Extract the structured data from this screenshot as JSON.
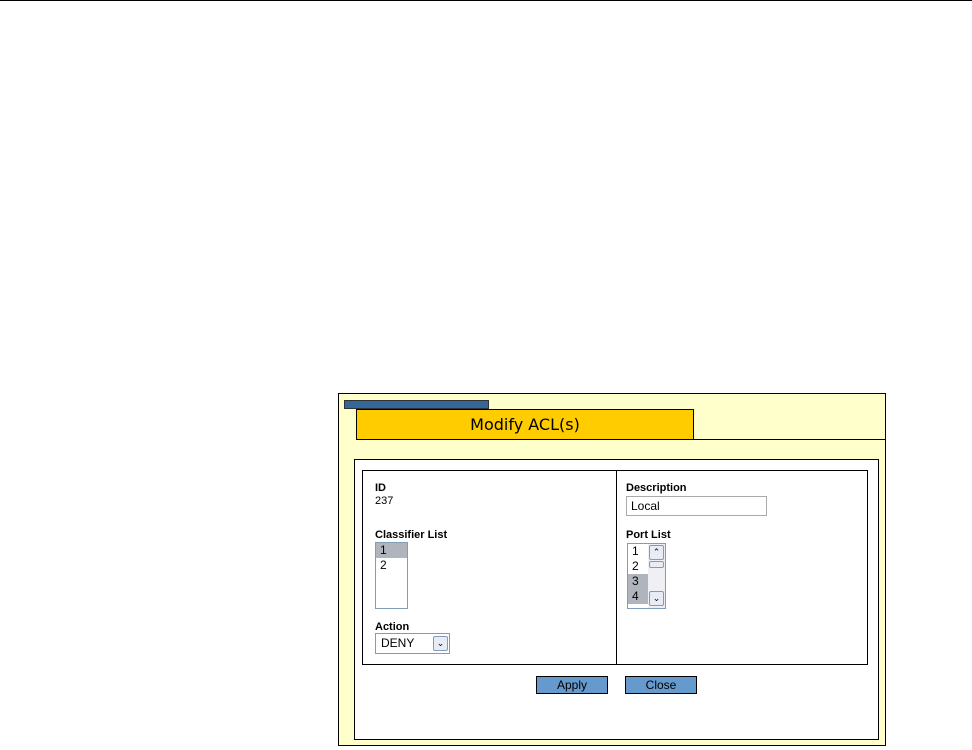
{
  "dialog": {
    "title": "Modify ACL(s)"
  },
  "form": {
    "id_label": "ID",
    "id_value": "237",
    "classifier_label": "Classifier List",
    "classifier_items": [
      "1",
      "2"
    ],
    "action_label": "Action",
    "action_value": "DENY",
    "description_label": "Description",
    "description_value": "Local",
    "port_label": "Port List",
    "port_items": [
      "1",
      "2",
      "3",
      "4"
    ]
  },
  "buttons": {
    "apply": "Apply",
    "close": "Close"
  },
  "colors": {
    "panel": "#ffffcc",
    "tab": "#ffcc00",
    "accent": "#336699",
    "button": "#6699cc"
  }
}
